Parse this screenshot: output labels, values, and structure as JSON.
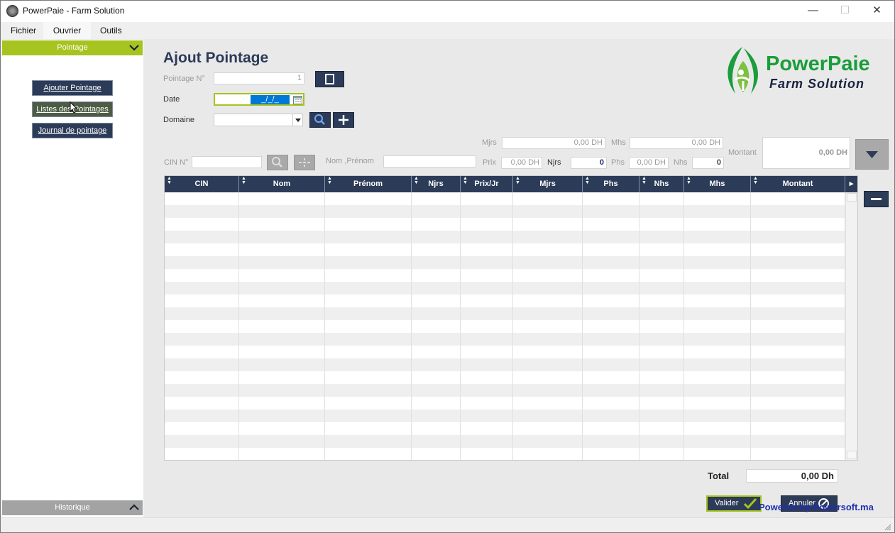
{
  "window": {
    "title": "PowerPaie - Farm Solution",
    "minimize": "—",
    "maximize": "☐",
    "close": "✕"
  },
  "menu": {
    "items": [
      "Fichier",
      "Ouvrier",
      "Outils"
    ],
    "active": "Ouvrier"
  },
  "sidebar": {
    "header": "Pointage",
    "footer": "Historique",
    "buttons": [
      {
        "label": "Ajouter Pointage",
        "color": "#2c3b57"
      },
      {
        "label": "Listes des Pointages",
        "color": "#4d5c45"
      },
      {
        "label": "Journal de pointage",
        "color": "#2c3b57"
      }
    ]
  },
  "form": {
    "title": "Ajout Pointage",
    "pointage_label": "Pointage N°",
    "pointage_value": "1",
    "date_label": "Date",
    "date_value": "_/_/_",
    "domaine_label": "Domaine",
    "domaine_value": "",
    "cin_label": "CIN N°",
    "cin_value": "",
    "nom_label": "Nom ,Prénom",
    "nom_value": "",
    "mjrs_label": "Mjrs",
    "mjrs_value": "0,00 DH",
    "mhs_label": "Mhs",
    "mhs_value": "0,00 DH",
    "prix_label": "Prix",
    "prix_value": "0,00 DH",
    "njrs_label": "Njrs",
    "njrs_value": "0",
    "phs_label": "Phs",
    "phs_value": "0,00 DH",
    "nhs_label": "Nhs",
    "nhs_value": "0",
    "montant_label": "Montant",
    "montant_value": "0,00 DH"
  },
  "table": {
    "columns": [
      "CIN",
      "Nom",
      "Prénom",
      "Njrs",
      "Prix/Jr",
      "Mjrs",
      "Phs",
      "Nhs",
      "Mhs",
      "Montant"
    ],
    "rows": []
  },
  "footer": {
    "total_label": "Total",
    "total_value": "0,00 Dh",
    "valider_label": "Valider",
    "annuler_label": "Annuler",
    "powered_text": "Powered by Powersoft.ma"
  },
  "logo": {
    "name": "PowerPaie",
    "tagline": "Farm Solution"
  },
  "colors": {
    "navy": "#2c3b57",
    "accent_green": "#a7c31f",
    "logo_green": "#1a9d3a",
    "powered_blue": "#1f2fb0"
  }
}
